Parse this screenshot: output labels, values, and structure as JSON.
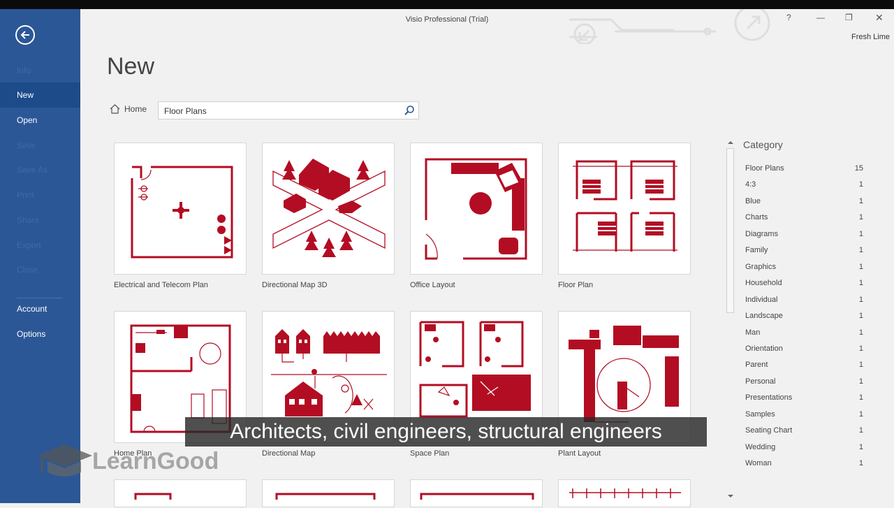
{
  "app": {
    "title": "Visio Professional (Trial)",
    "user": "Fresh Lime"
  },
  "window_controls": [
    "?",
    "—",
    "❐",
    "✕"
  ],
  "sidebar": {
    "items": [
      {
        "label": "Info",
        "state": "dim"
      },
      {
        "label": "New",
        "state": "selected"
      },
      {
        "label": "Open",
        "state": "normal"
      },
      {
        "label": "Save",
        "state": "dim"
      },
      {
        "label": "Save As",
        "state": "dim"
      },
      {
        "label": "Print",
        "state": "dim"
      },
      {
        "label": "Share",
        "state": "dim"
      },
      {
        "label": "Export",
        "state": "dim"
      },
      {
        "label": "Close",
        "state": "dim"
      },
      {
        "label": "Account",
        "state": "normal"
      },
      {
        "label": "Options",
        "state": "normal"
      }
    ]
  },
  "main": {
    "heading": "New",
    "home_label": "Home",
    "search_value": "Floor Plans",
    "templates": [
      {
        "label": "Electrical and Telecom Plan"
      },
      {
        "label": "Directional Map 3D"
      },
      {
        "label": "Office Layout"
      },
      {
        "label": "Floor Plan"
      },
      {
        "label": "Home Plan"
      },
      {
        "label": "Directional Map"
      },
      {
        "label": "Space Plan"
      },
      {
        "label": "Plant Layout"
      }
    ]
  },
  "category": {
    "title": "Category",
    "items": [
      {
        "name": "Floor Plans",
        "count": "15"
      },
      {
        "name": "4:3",
        "count": "1"
      },
      {
        "name": "Blue",
        "count": "1"
      },
      {
        "name": "Charts",
        "count": "1"
      },
      {
        "name": "Diagrams",
        "count": "1"
      },
      {
        "name": "Family",
        "count": "1"
      },
      {
        "name": "Graphics",
        "count": "1"
      },
      {
        "name": "Household",
        "count": "1"
      },
      {
        "name": "Individual",
        "count": "1"
      },
      {
        "name": "Landscape",
        "count": "1"
      },
      {
        "name": "Man",
        "count": "1"
      },
      {
        "name": "Orientation",
        "count": "1"
      },
      {
        "name": "Parent",
        "count": "1"
      },
      {
        "name": "Personal",
        "count": "1"
      },
      {
        "name": "Presentations",
        "count": "1"
      },
      {
        "name": "Samples",
        "count": "1"
      },
      {
        "name": "Seating Chart",
        "count": "1"
      },
      {
        "name": "Wedding",
        "count": "1"
      },
      {
        "name": "Woman",
        "count": "1"
      }
    ]
  },
  "caption": "Architects, civil engineers, structural engineers",
  "watermark": "LearnGood",
  "colors": {
    "sidebar": "#2b5797",
    "accent": "#b30d23"
  }
}
